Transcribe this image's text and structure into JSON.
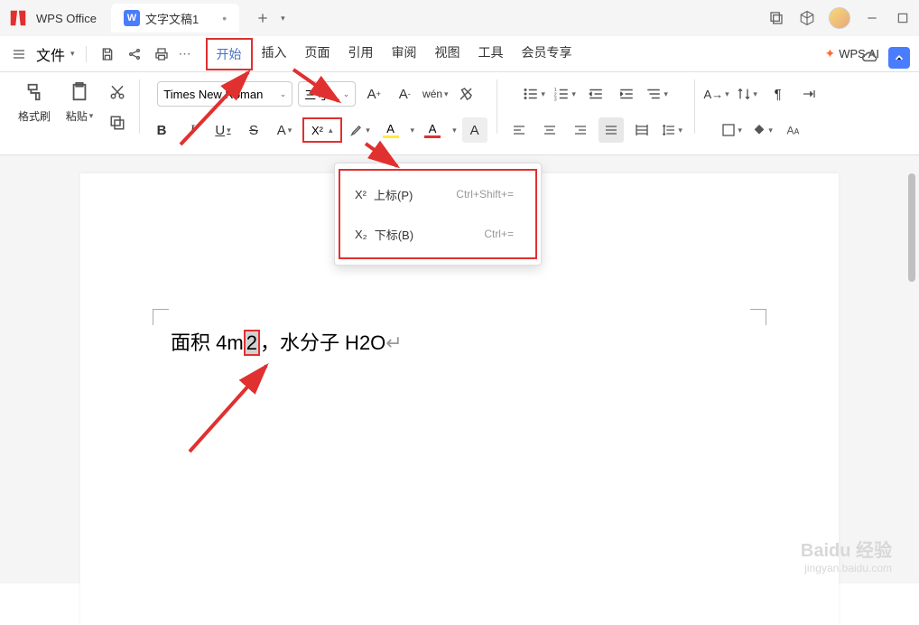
{
  "app": {
    "name": "WPS Office"
  },
  "tab": {
    "title": "文字文稿1"
  },
  "menu": {
    "file": "文件",
    "tabs": [
      "开始",
      "插入",
      "页面",
      "引用",
      "审阅",
      "视图",
      "工具",
      "会员专享"
    ],
    "active": 0,
    "wps_ai": "WPS AI"
  },
  "ribbon": {
    "format_painter": "格式刷",
    "paste": "粘贴",
    "font_name": "Times New Roman",
    "font_size": "三号",
    "script_label": "X²"
  },
  "popup": {
    "superscript": {
      "icon": "X²",
      "label": "上标(P)",
      "shortcut": "Ctrl+Shift+="
    },
    "subscript": {
      "icon": "X₂",
      "label": "下标(B)",
      "shortcut": "Ctrl+="
    }
  },
  "document": {
    "text_before": "面积 4m",
    "selected": "2",
    "text_after": "，水分子 H2O"
  },
  "watermark": {
    "brand": "Baidu",
    "sub": "经验",
    "url": "jingyan.baidu.com"
  }
}
